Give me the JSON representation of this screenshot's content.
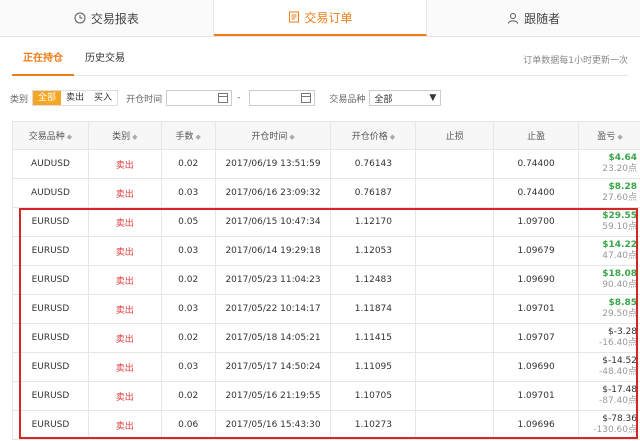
{
  "tabs": [
    {
      "label": "交易报表",
      "icon": "clock-icon"
    },
    {
      "label": "交易订单",
      "icon": "document-icon"
    },
    {
      "label": "跟随者",
      "icon": "user-icon"
    }
  ],
  "subtabs": [
    "正在持仓",
    "历史交易"
  ],
  "note": "订单数据每1小时更新一次",
  "filter": {
    "type_label": "类别",
    "types": [
      "全部",
      "卖出",
      "买入"
    ],
    "time_label": "开仓时间",
    "dash": "-",
    "symbol_label": "交易品种",
    "symbol_value": "全部"
  },
  "table": {
    "headers": [
      "交易品种",
      "类别",
      "手数",
      "开仓时间",
      "开仓价格",
      "止损",
      "止盈",
      "盈亏"
    ],
    "rows": [
      {
        "symbol": "AUDUSD",
        "type": "卖出",
        "lots": "0.02",
        "time": "2017/06/19 13:51:59",
        "price": "0.76143",
        "sl": "",
        "tp": "0.74400",
        "profit": "$4.64",
        "points": "23.20点",
        "pos": true
      },
      {
        "symbol": "AUDUSD",
        "type": "卖出",
        "lots": "0.03",
        "time": "2017/06/16 23:09:32",
        "price": "0.76187",
        "sl": "",
        "tp": "0.74400",
        "profit": "$8.28",
        "points": "27.60点",
        "pos": true
      },
      {
        "symbol": "EURUSD",
        "type": "卖出",
        "lots": "0.05",
        "time": "2017/06/15 10:47:34",
        "price": "1.12170",
        "sl": "",
        "tp": "1.09700",
        "profit": "$29.55",
        "points": "59.10点",
        "pos": true
      },
      {
        "symbol": "EURUSD",
        "type": "卖出",
        "lots": "0.03",
        "time": "2017/06/14 19:29:18",
        "price": "1.12053",
        "sl": "",
        "tp": "1.09679",
        "profit": "$14.22",
        "points": "47.40点",
        "pos": true
      },
      {
        "symbol": "EURUSD",
        "type": "卖出",
        "lots": "0.02",
        "time": "2017/05/23 11:04:23",
        "price": "1.12483",
        "sl": "",
        "tp": "1.09690",
        "profit": "$18.08",
        "points": "90.40点",
        "pos": true
      },
      {
        "symbol": "EURUSD",
        "type": "卖出",
        "lots": "0.03",
        "time": "2017/05/22 10:14:17",
        "price": "1.11874",
        "sl": "",
        "tp": "1.09701",
        "profit": "$8.85",
        "points": "29.50点",
        "pos": true
      },
      {
        "symbol": "EURUSD",
        "type": "卖出",
        "lots": "0.02",
        "time": "2017/05/18 14:05:21",
        "price": "1.11415",
        "sl": "",
        "tp": "1.09707",
        "profit": "$-3.28",
        "points": "-16.40点",
        "pos": false
      },
      {
        "symbol": "EURUSD",
        "type": "卖出",
        "lots": "0.03",
        "time": "2017/05/17 14:50:24",
        "price": "1.11095",
        "sl": "",
        "tp": "1.09690",
        "profit": "$-14.52",
        "points": "-48.40点",
        "pos": false
      },
      {
        "symbol": "EURUSD",
        "type": "卖出",
        "lots": "0.02",
        "time": "2017/05/16 21:19:55",
        "price": "1.10705",
        "sl": "",
        "tp": "1.09701",
        "profit": "$-17.48",
        "points": "-87.40点",
        "pos": false
      },
      {
        "symbol": "EURUSD",
        "type": "卖出",
        "lots": "0.06",
        "time": "2017/05/16 15:43:30",
        "price": "1.10273",
        "sl": "",
        "tp": "1.09696",
        "profit": "$-78.36",
        "points": "-130.60点",
        "pos": false
      }
    ]
  },
  "colors": {
    "accent": "#f07d1a",
    "sell": "#e04040",
    "positive": "#3aa64a",
    "highlight": "#d52626"
  }
}
